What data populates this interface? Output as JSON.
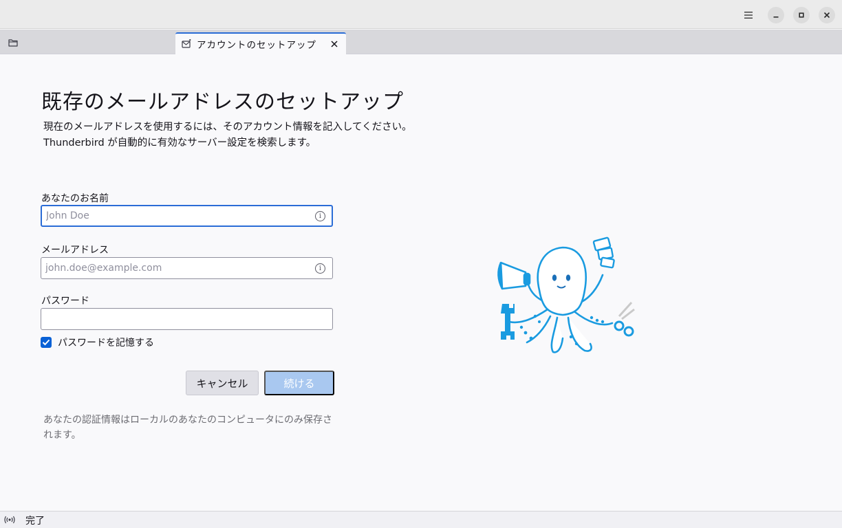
{
  "window": {
    "controls": {
      "menu_icon": "hamburger-menu-icon",
      "minimize_icon": "minimize-icon",
      "maximize_icon": "maximize-icon",
      "close_icon": "close-icon"
    }
  },
  "tabs": {
    "folder_icon": "folder-icon",
    "active": {
      "label": "アカウントのセットアップ",
      "icon": "mail-setup-icon",
      "close_icon": "close-icon"
    }
  },
  "setup": {
    "title": "既存のメールアドレスのセットアップ",
    "description_line1": "現在のメールアドレスを使用するには、そのアカウント情報を記入してください。",
    "description_line2": "Thunderbird が自動的に有効なサーバー設定を検索します。",
    "name_field": {
      "label": "あなたのお名前",
      "placeholder": "John Doe",
      "value": ""
    },
    "email_field": {
      "label": "メールアドレス",
      "placeholder": "john.doe@example.com",
      "value": ""
    },
    "password_field": {
      "label": "パスワード",
      "value": ""
    },
    "remember_password": {
      "label": "パスワードを記憶する",
      "checked": true
    },
    "cancel_label": "キャンセル",
    "continue_label": "続ける",
    "note": "あなたの認証情報はローカルのあなたのコンピュータにのみ保存されます。",
    "accent_color": "#0a61d6"
  },
  "status": {
    "icon": "activity-icon",
    "text": "完了"
  }
}
